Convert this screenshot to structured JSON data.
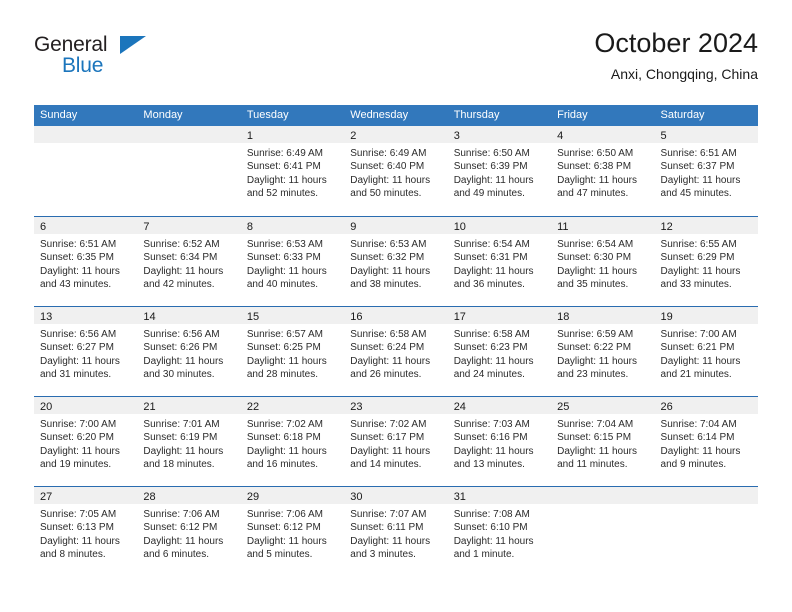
{
  "brand": {
    "name_part1": "General",
    "name_part2": "Blue",
    "accent_color": "#1b75bc"
  },
  "header": {
    "title": "October 2024",
    "location": "Anxi, Chongqing, China"
  },
  "theme": {
    "header_row_bg": "#3278bc",
    "week_divider": "#2a6cb0",
    "daynum_band_bg": "#f0f0f0",
    "text_color": "#2b2b2b"
  },
  "weekday_headers": [
    "Sunday",
    "Monday",
    "Tuesday",
    "Wednesday",
    "Thursday",
    "Friday",
    "Saturday"
  ],
  "weeks": [
    [
      {
        "day": "",
        "sunrise": "",
        "sunset": "",
        "daylight_line1": "",
        "daylight_line2": "",
        "empty": true
      },
      {
        "day": "",
        "sunrise": "",
        "sunset": "",
        "daylight_line1": "",
        "daylight_line2": "",
        "empty": true
      },
      {
        "day": "1",
        "sunrise": "Sunrise: 6:49 AM",
        "sunset": "Sunset: 6:41 PM",
        "daylight_line1": "Daylight: 11 hours",
        "daylight_line2": "and 52 minutes."
      },
      {
        "day": "2",
        "sunrise": "Sunrise: 6:49 AM",
        "sunset": "Sunset: 6:40 PM",
        "daylight_line1": "Daylight: 11 hours",
        "daylight_line2": "and 50 minutes."
      },
      {
        "day": "3",
        "sunrise": "Sunrise: 6:50 AM",
        "sunset": "Sunset: 6:39 PM",
        "daylight_line1": "Daylight: 11 hours",
        "daylight_line2": "and 49 minutes."
      },
      {
        "day": "4",
        "sunrise": "Sunrise: 6:50 AM",
        "sunset": "Sunset: 6:38 PM",
        "daylight_line1": "Daylight: 11 hours",
        "daylight_line2": "and 47 minutes."
      },
      {
        "day": "5",
        "sunrise": "Sunrise: 6:51 AM",
        "sunset": "Sunset: 6:37 PM",
        "daylight_line1": "Daylight: 11 hours",
        "daylight_line2": "and 45 minutes."
      }
    ],
    [
      {
        "day": "6",
        "sunrise": "Sunrise: 6:51 AM",
        "sunset": "Sunset: 6:35 PM",
        "daylight_line1": "Daylight: 11 hours",
        "daylight_line2": "and 43 minutes."
      },
      {
        "day": "7",
        "sunrise": "Sunrise: 6:52 AM",
        "sunset": "Sunset: 6:34 PM",
        "daylight_line1": "Daylight: 11 hours",
        "daylight_line2": "and 42 minutes."
      },
      {
        "day": "8",
        "sunrise": "Sunrise: 6:53 AM",
        "sunset": "Sunset: 6:33 PM",
        "daylight_line1": "Daylight: 11 hours",
        "daylight_line2": "and 40 minutes."
      },
      {
        "day": "9",
        "sunrise": "Sunrise: 6:53 AM",
        "sunset": "Sunset: 6:32 PM",
        "daylight_line1": "Daylight: 11 hours",
        "daylight_line2": "and 38 minutes."
      },
      {
        "day": "10",
        "sunrise": "Sunrise: 6:54 AM",
        "sunset": "Sunset: 6:31 PM",
        "daylight_line1": "Daylight: 11 hours",
        "daylight_line2": "and 36 minutes."
      },
      {
        "day": "11",
        "sunrise": "Sunrise: 6:54 AM",
        "sunset": "Sunset: 6:30 PM",
        "daylight_line1": "Daylight: 11 hours",
        "daylight_line2": "and 35 minutes."
      },
      {
        "day": "12",
        "sunrise": "Sunrise: 6:55 AM",
        "sunset": "Sunset: 6:29 PM",
        "daylight_line1": "Daylight: 11 hours",
        "daylight_line2": "and 33 minutes."
      }
    ],
    [
      {
        "day": "13",
        "sunrise": "Sunrise: 6:56 AM",
        "sunset": "Sunset: 6:27 PM",
        "daylight_line1": "Daylight: 11 hours",
        "daylight_line2": "and 31 minutes."
      },
      {
        "day": "14",
        "sunrise": "Sunrise: 6:56 AM",
        "sunset": "Sunset: 6:26 PM",
        "daylight_line1": "Daylight: 11 hours",
        "daylight_line2": "and 30 minutes."
      },
      {
        "day": "15",
        "sunrise": "Sunrise: 6:57 AM",
        "sunset": "Sunset: 6:25 PM",
        "daylight_line1": "Daylight: 11 hours",
        "daylight_line2": "and 28 minutes."
      },
      {
        "day": "16",
        "sunrise": "Sunrise: 6:58 AM",
        "sunset": "Sunset: 6:24 PM",
        "daylight_line1": "Daylight: 11 hours",
        "daylight_line2": "and 26 minutes."
      },
      {
        "day": "17",
        "sunrise": "Sunrise: 6:58 AM",
        "sunset": "Sunset: 6:23 PM",
        "daylight_line1": "Daylight: 11 hours",
        "daylight_line2": "and 24 minutes."
      },
      {
        "day": "18",
        "sunrise": "Sunrise: 6:59 AM",
        "sunset": "Sunset: 6:22 PM",
        "daylight_line1": "Daylight: 11 hours",
        "daylight_line2": "and 23 minutes."
      },
      {
        "day": "19",
        "sunrise": "Sunrise: 7:00 AM",
        "sunset": "Sunset: 6:21 PM",
        "daylight_line1": "Daylight: 11 hours",
        "daylight_line2": "and 21 minutes."
      }
    ],
    [
      {
        "day": "20",
        "sunrise": "Sunrise: 7:00 AM",
        "sunset": "Sunset: 6:20 PM",
        "daylight_line1": "Daylight: 11 hours",
        "daylight_line2": "and 19 minutes."
      },
      {
        "day": "21",
        "sunrise": "Sunrise: 7:01 AM",
        "sunset": "Sunset: 6:19 PM",
        "daylight_line1": "Daylight: 11 hours",
        "daylight_line2": "and 18 minutes."
      },
      {
        "day": "22",
        "sunrise": "Sunrise: 7:02 AM",
        "sunset": "Sunset: 6:18 PM",
        "daylight_line1": "Daylight: 11 hours",
        "daylight_line2": "and 16 minutes."
      },
      {
        "day": "23",
        "sunrise": "Sunrise: 7:02 AM",
        "sunset": "Sunset: 6:17 PM",
        "daylight_line1": "Daylight: 11 hours",
        "daylight_line2": "and 14 minutes."
      },
      {
        "day": "24",
        "sunrise": "Sunrise: 7:03 AM",
        "sunset": "Sunset: 6:16 PM",
        "daylight_line1": "Daylight: 11 hours",
        "daylight_line2": "and 13 minutes."
      },
      {
        "day": "25",
        "sunrise": "Sunrise: 7:04 AM",
        "sunset": "Sunset: 6:15 PM",
        "daylight_line1": "Daylight: 11 hours",
        "daylight_line2": "and 11 minutes."
      },
      {
        "day": "26",
        "sunrise": "Sunrise: 7:04 AM",
        "sunset": "Sunset: 6:14 PM",
        "daylight_line1": "Daylight: 11 hours",
        "daylight_line2": "and 9 minutes."
      }
    ],
    [
      {
        "day": "27",
        "sunrise": "Sunrise: 7:05 AM",
        "sunset": "Sunset: 6:13 PM",
        "daylight_line1": "Daylight: 11 hours",
        "daylight_line2": "and 8 minutes."
      },
      {
        "day": "28",
        "sunrise": "Sunrise: 7:06 AM",
        "sunset": "Sunset: 6:12 PM",
        "daylight_line1": "Daylight: 11 hours",
        "daylight_line2": "and 6 minutes."
      },
      {
        "day": "29",
        "sunrise": "Sunrise: 7:06 AM",
        "sunset": "Sunset: 6:12 PM",
        "daylight_line1": "Daylight: 11 hours",
        "daylight_line2": "and 5 minutes."
      },
      {
        "day": "30",
        "sunrise": "Sunrise: 7:07 AM",
        "sunset": "Sunset: 6:11 PM",
        "daylight_line1": "Daylight: 11 hours",
        "daylight_line2": "and 3 minutes."
      },
      {
        "day": "31",
        "sunrise": "Sunrise: 7:08 AM",
        "sunset": "Sunset: 6:10 PM",
        "daylight_line1": "Daylight: 11 hours",
        "daylight_line2": "and 1 minute."
      },
      {
        "day": "",
        "sunrise": "",
        "sunset": "",
        "daylight_line1": "",
        "daylight_line2": "",
        "empty": true
      },
      {
        "day": "",
        "sunrise": "",
        "sunset": "",
        "daylight_line1": "",
        "daylight_line2": "",
        "empty": true
      }
    ]
  ]
}
